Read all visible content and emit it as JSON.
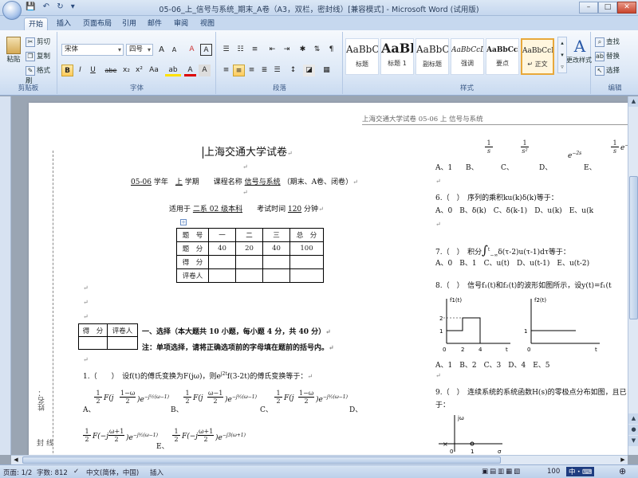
{
  "window": {
    "title": "05-06_上_信号与系统_期末_A卷（A3，双栏，密封线）[兼容模式] - Microsoft Word (试用版)",
    "controls": [
      "–",
      "□",
      "✕"
    ]
  },
  "qat": {
    "save": "💾",
    "undo": "↶",
    "redo": "↻",
    "more": "▾"
  },
  "tabs": [
    "开始",
    "插入",
    "页面布局",
    "引用",
    "邮件",
    "审阅",
    "视图"
  ],
  "ribbon": {
    "clipboard": {
      "label": "剪贴板",
      "paste": "粘贴",
      "cut": "剪切",
      "copy": "复制",
      "format_painter": "格式刷"
    },
    "font": {
      "label": "字体",
      "font_name": "宋体",
      "font_size": "四号",
      "grow": "A",
      "shrink": "A",
      "clear": "A",
      "bold": "B",
      "italic": "I",
      "underline": "U",
      "strike": "abe",
      "sub": "x₂",
      "sup": "x²",
      "case": "Aa",
      "highlight": "ab",
      "color": "A",
      "charborder": "A"
    },
    "paragraph": {
      "label": "段落"
    },
    "styles": {
      "label": "样式",
      "items": [
        {
          "sample": "AaBbC",
          "name": "标题"
        },
        {
          "sample": "AaBl",
          "name": "标题 1"
        },
        {
          "sample": "AaBbC",
          "name": "副标题"
        },
        {
          "sample": "AaBbCcD",
          "name": "强调"
        },
        {
          "sample": "AaBbCcD",
          "name": "要点"
        },
        {
          "sample": "AaBbCcD",
          "name": "↵ 正文"
        }
      ],
      "change": "更改样式"
    },
    "editing": {
      "label": "编辑",
      "find": "查找",
      "replace": "替换",
      "select": "选择"
    }
  },
  "document": {
    "header": "上海交通大学试卷   05-06   上   信号与系统",
    "title": "上海交通大学试卷",
    "meta_line": {
      "year": "05-06",
      "year_suffix": "学年",
      "term": "上",
      "term_suffix": "学期",
      "course_label": "课程名称",
      "course": "信号与系统",
      "tail": "（期末、A卷、闭卷）"
    },
    "applies_line": {
      "label": "适用于",
      "target": "二系 02 级本科",
      "time_label": "考试时间",
      "time": "120",
      "time_unit": "分钟"
    },
    "score_table": [
      [
        "题　号",
        "一",
        "二",
        "三",
        "总　分"
      ],
      [
        "题　分",
        "40",
        "20",
        "40",
        "100"
      ],
      [
        "得　分",
        "",
        "",
        "",
        ""
      ],
      [
        "评卷人",
        "",
        "",
        "",
        ""
      ]
    ],
    "grader_table": [
      "得　分",
      "评卷人"
    ],
    "section_title": "一、选择（本大题共 10 小题，每小题 4 分，共 40 分）",
    "section_note": "注：单项选择，请将正确选项前的字母填在题前的括号内。",
    "q1": "1.（　　）　设f(t)的傅氏变换为F(jω)，则e",
    "q1_tail": "f(3-2t)的傅氏变换等于：",
    "q1_options": [
      "A、",
      "B、",
      "C、",
      "D、",
      "E、"
    ],
    "left_margin_labels": [
      "姓名：",
      "封",
      "线"
    ],
    "right": {
      "q5_options": [
        "A、1",
        "B、",
        "C、",
        "D、",
        "E、"
      ],
      "q6": "6.（　）　序列的乘积ku(k)δ(k)等于：",
      "q6_options": [
        "A、0",
        "B、δ(k)",
        "C、δ(k-1)",
        "D、u(k)",
        "E、u(k"
      ],
      "q7_prefix": "7.（　）　积分",
      "q7_integral": "δ(τ-2)u(τ-1)dτ",
      "q7_suffix": "等于：",
      "q7_options": [
        "A、0",
        "B、1",
        "C、u(t)",
        "D、u(t-1)",
        "E、u(t-2)"
      ],
      "q8": "8.（　）　信号f₁(t)和f₂(t)的波形如图所示，设y(t)=f₁(t",
      "q8_options": [
        "A、1",
        "B、2",
        "C、3",
        "D、4",
        "E、5"
      ],
      "q9": "9.（　）　连续系统的系统函数H(s)的零极点分布如图，且已",
      "q9_cont": "于：",
      "fig1": {
        "ylabel": "f1(t)",
        "xlabel": "t",
        "ticks_x": [
          "0",
          "2",
          "4"
        ],
        "ticks_y": [
          "1",
          "2"
        ]
      },
      "fig2": {
        "ylabel": "f2(t)",
        "xlabel": "t",
        "ticks_x": [
          "0"
        ],
        "ticks_y": [
          "1"
        ]
      },
      "fig3": {
        "ylabel": "jω",
        "xlabel": "σ",
        "ticks_x": [
          "0",
          "1"
        ]
      }
    }
  },
  "status": {
    "page": "页面: 1/2",
    "words": "字数: 812",
    "lang": "中文(简体，中国)",
    "mode": "插入",
    "zoom": "100"
  }
}
